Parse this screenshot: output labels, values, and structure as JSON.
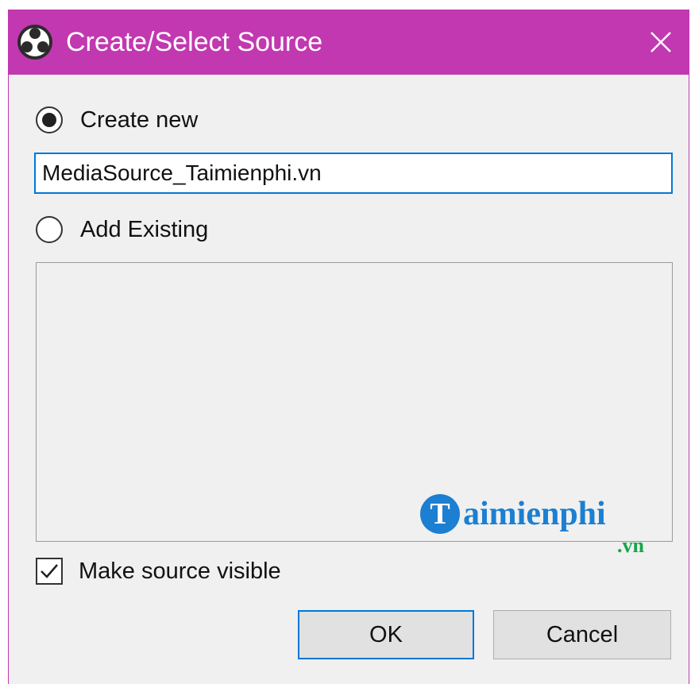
{
  "window": {
    "title": "Create/Select Source",
    "app_icon": "obs-logo-icon",
    "close_icon": "close-icon",
    "accent_color": "#c238b0"
  },
  "options": {
    "create_new_label": "Create new",
    "create_new_selected": true,
    "source_name_value": "MediaSource_Taimienphi.vn",
    "add_existing_label": "Add Existing",
    "add_existing_selected": false,
    "existing_sources": []
  },
  "visibility": {
    "label": "Make source visible",
    "checked": true
  },
  "buttons": {
    "ok_label": "OK",
    "cancel_label": "Cancel"
  },
  "watermark": {
    "logo_letter": "T",
    "text": "aimienphi",
    "suffix": ".vn",
    "color": "#1c7fd1",
    "suffix_color": "#18a54a"
  }
}
